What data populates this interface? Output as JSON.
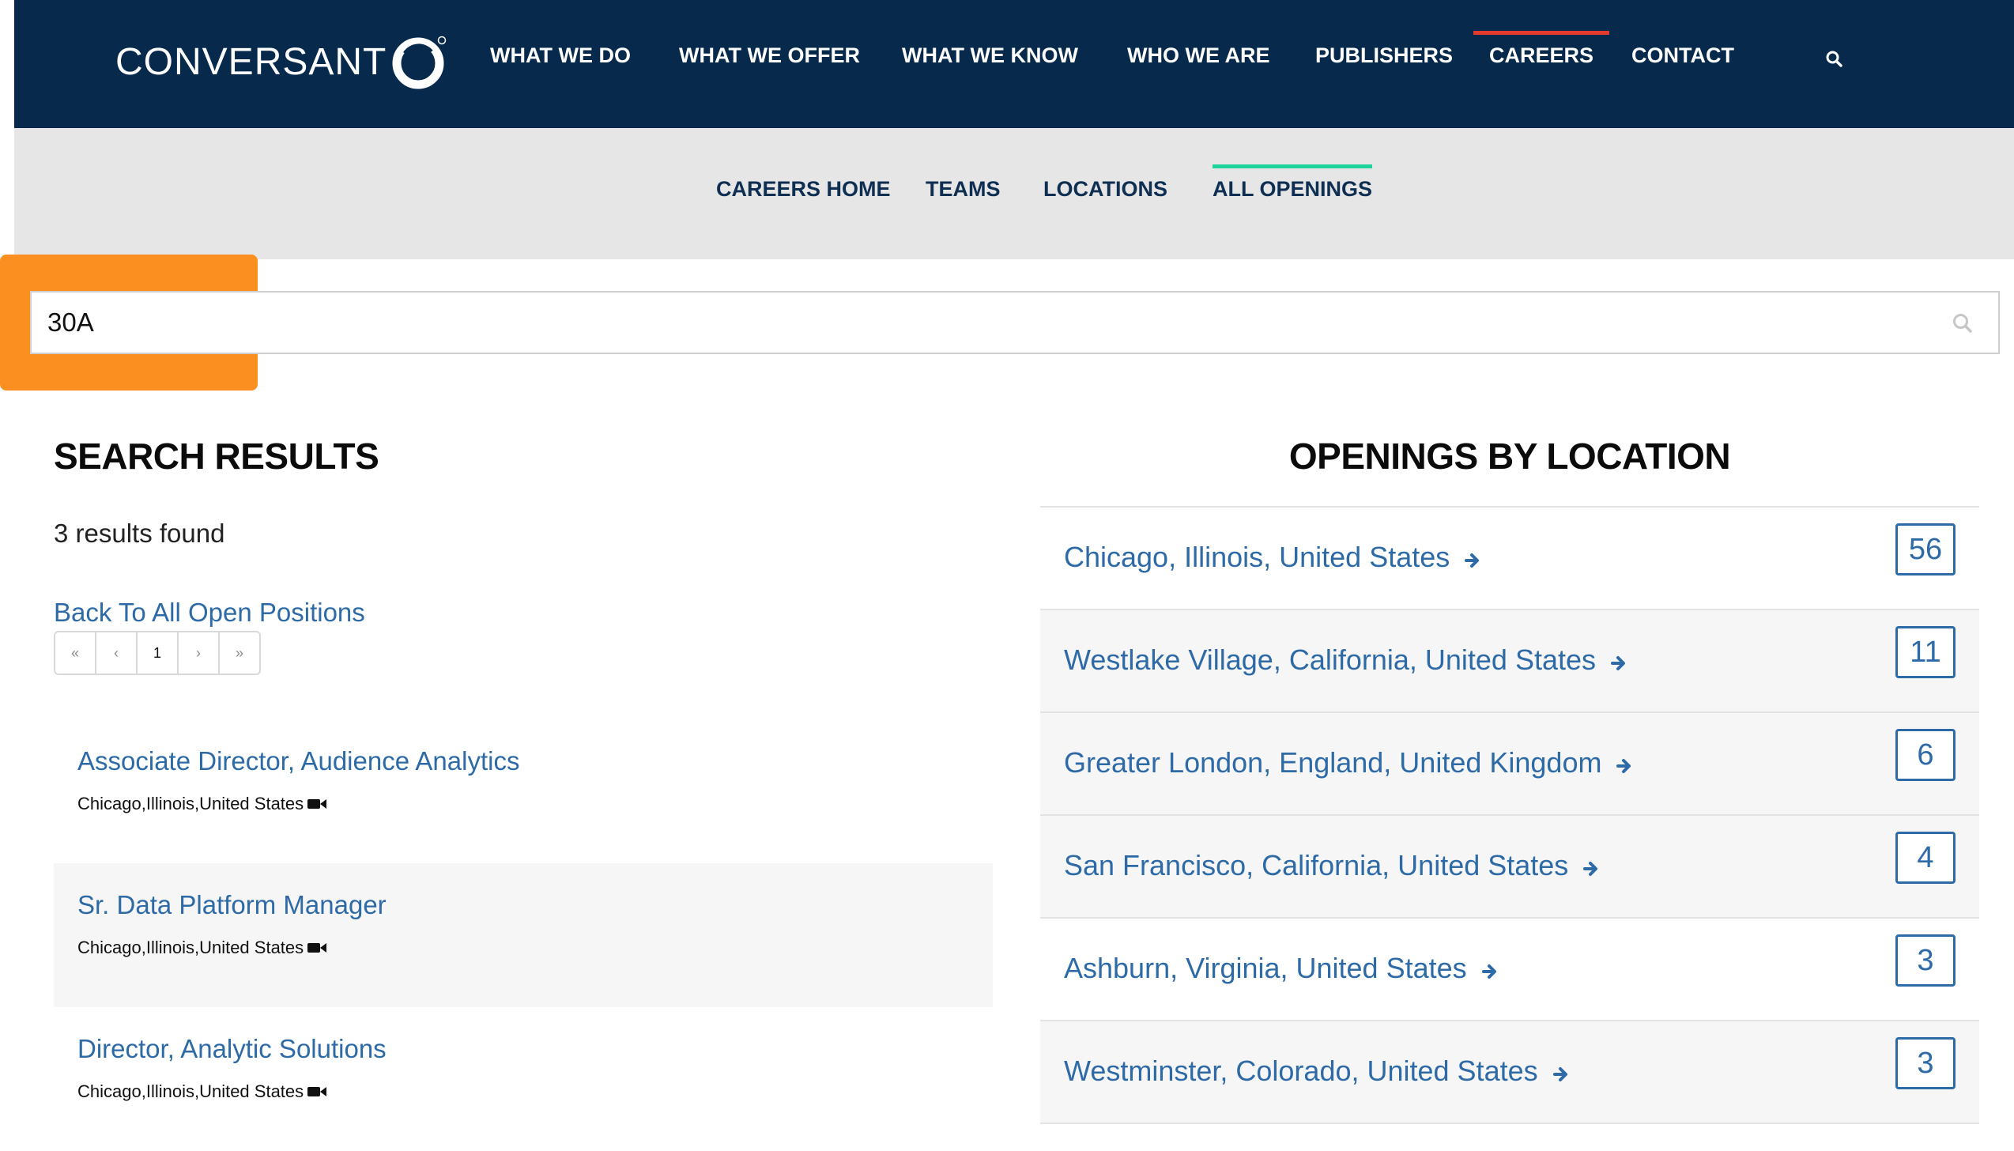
{
  "brand": {
    "logo_text": "CONVERSANT"
  },
  "topnav": {
    "items": [
      {
        "label": "WHAT WE DO"
      },
      {
        "label": "WHAT WE OFFER"
      },
      {
        "label": "WHAT WE KNOW"
      },
      {
        "label": "WHO WE ARE"
      },
      {
        "label": "PUBLISHERS"
      },
      {
        "label": "CAREERS",
        "active": true
      },
      {
        "label": "CONTACT"
      }
    ],
    "search_icon": "search-icon"
  },
  "subnav": {
    "items": [
      {
        "label": "CAREERS HOME"
      },
      {
        "label": "TEAMS"
      },
      {
        "label": "LOCATIONS"
      },
      {
        "label": "ALL OPENINGS",
        "active": true
      }
    ]
  },
  "search": {
    "value": "30A",
    "icon": "search-icon"
  },
  "results": {
    "heading": "SEARCH RESULTS",
    "count_text": "3 results found",
    "back_link": "Back To All Open Positions",
    "pager": {
      "first": "«",
      "prev": "‹",
      "current": "1",
      "next": "›",
      "last": "»"
    },
    "jobs": [
      {
        "title": "Associate Director, Audience Analytics",
        "location": "Chicago,Illinois,United States",
        "icon": "video-camera-icon"
      },
      {
        "title": "Sr. Data Platform Manager",
        "location": "Chicago,Illinois,United States",
        "icon": "video-camera-icon"
      },
      {
        "title": "Director, Analytic Solutions",
        "location": "Chicago,Illinois,United States",
        "icon": "video-camera-icon"
      }
    ]
  },
  "locations": {
    "heading": "OPENINGS BY LOCATION",
    "items": [
      {
        "name": "Chicago, Illinois, United States",
        "count": "56"
      },
      {
        "name": "Westlake Village, California, United States",
        "count": "11"
      },
      {
        "name": "Greater London, England, United Kingdom",
        "count": "6"
      },
      {
        "name": "San Francisco, California, United States",
        "count": "4"
      },
      {
        "name": "Ashburn, Virginia, United States",
        "count": "3"
      },
      {
        "name": "Westminster, Colorado, United States",
        "count": "3"
      }
    ]
  },
  "colors": {
    "nav_bg": "#06294c",
    "subnav_bg": "#e6e6e6",
    "link_blue": "#2d6aa6",
    "careers_underline": "#e23b2e",
    "openings_underline": "#1fd39c",
    "highlight_orange": "#fb8f1f"
  }
}
